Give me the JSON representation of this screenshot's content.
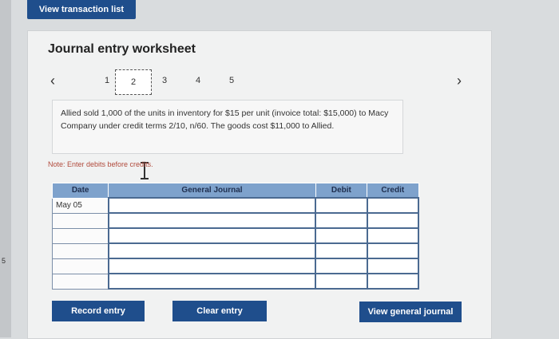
{
  "top_button": "View transaction list",
  "worksheet": {
    "title": "Journal entry worksheet",
    "pages": [
      "1",
      "2",
      "3",
      "4",
      "5"
    ],
    "active_page": "2",
    "prev_icon": "chevron-left-icon",
    "next_icon": "chevron-right-icon",
    "description": "Allied sold 1,000 of the units in inventory for $15 per unit (invoice total: $15,000) to Macy Company under credit terms 2/10, n/60. The goods cost $11,000 to Allied.",
    "note": "Note: Enter debits before credits.",
    "table": {
      "headers": [
        "Date",
        "General Journal",
        "Debit",
        "Credit"
      ],
      "rows": [
        {
          "date": "May 05",
          "account": "",
          "debit": "",
          "credit": ""
        },
        {
          "date": "",
          "account": "",
          "debit": "",
          "credit": ""
        },
        {
          "date": "",
          "account": "",
          "debit": "",
          "credit": ""
        },
        {
          "date": "",
          "account": "",
          "debit": "",
          "credit": ""
        },
        {
          "date": "",
          "account": "",
          "debit": "",
          "credit": ""
        },
        {
          "date": "",
          "account": "",
          "debit": "",
          "credit": ""
        }
      ]
    },
    "buttons": {
      "record": "Record entry",
      "clear": "Clear entry",
      "view_journal": "View general journal"
    }
  },
  "edge_text": "5",
  "colors": {
    "button_bg": "#1f4e8c",
    "header_bg": "#7ea2cc",
    "note_text": "#b14a3c"
  }
}
